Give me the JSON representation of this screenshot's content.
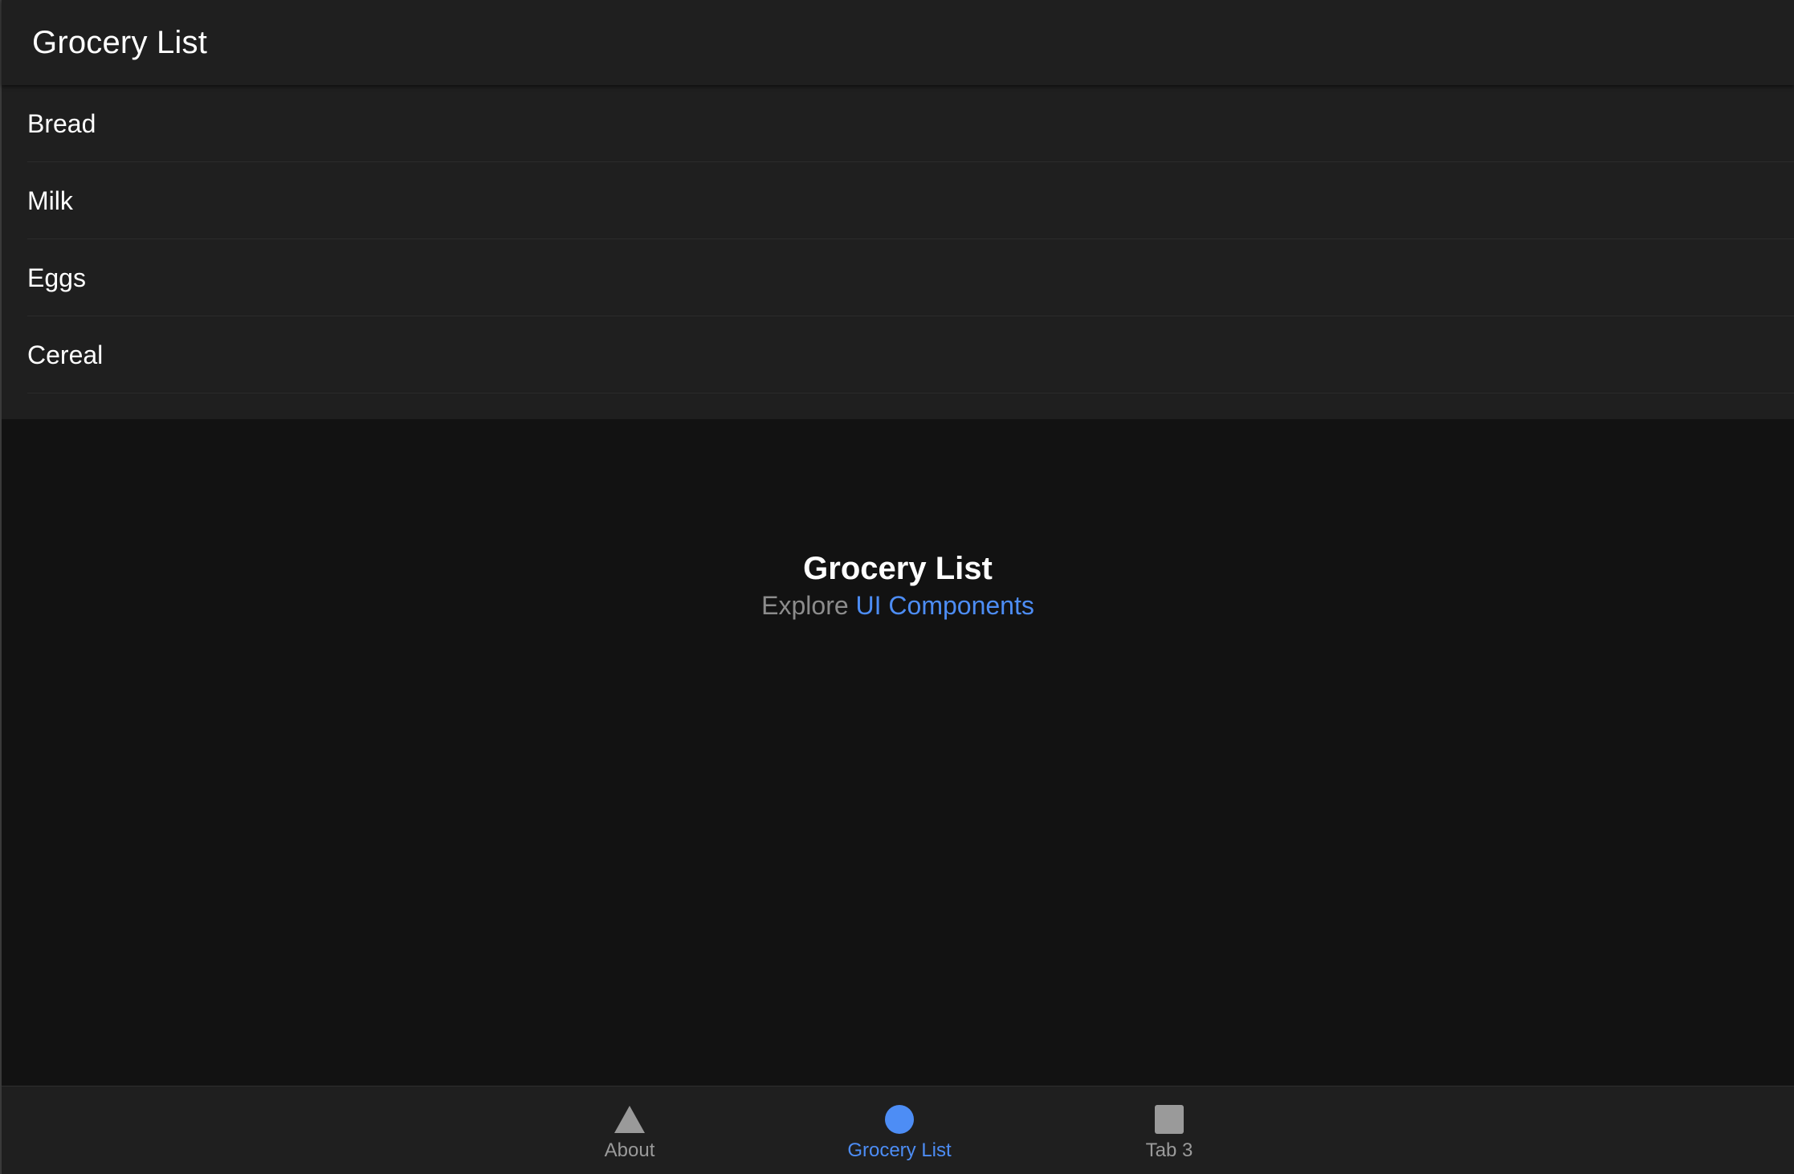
{
  "header": {
    "title": "Grocery List"
  },
  "list": {
    "items": [
      {
        "label": "Bread"
      },
      {
        "label": "Milk"
      },
      {
        "label": "Eggs"
      },
      {
        "label": "Cereal"
      }
    ]
  },
  "content": {
    "title": "Grocery List",
    "subtitle_prefix": "Explore",
    "link_text": "UI Components"
  },
  "tabbar": {
    "tabs": [
      {
        "label": "About",
        "icon": "triangle-icon",
        "active": false
      },
      {
        "label": "Grocery List",
        "icon": "circle-icon",
        "active": true
      },
      {
        "label": "Tab 3",
        "icon": "square-icon",
        "active": false
      }
    ]
  },
  "colors": {
    "accent": "#4d8df5",
    "background": "#121212",
    "surface": "#1f1f1f",
    "inactive": "#9a9a9a"
  }
}
